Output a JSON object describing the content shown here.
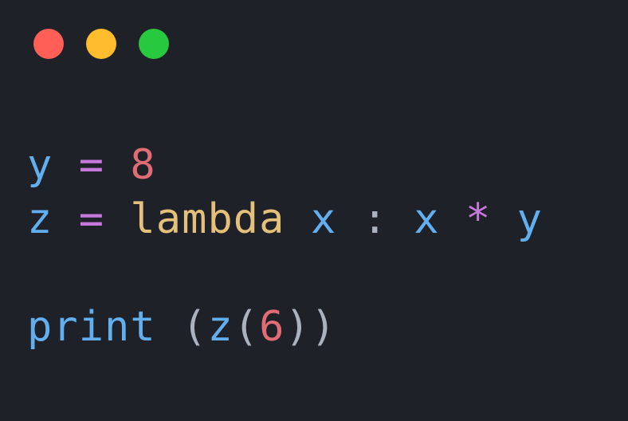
{
  "window_controls": {
    "close": "close",
    "minimize": "minimize",
    "maximize": "maximize"
  },
  "code": {
    "line1": {
      "var_y": "y",
      "eq": " = ",
      "val": "8"
    },
    "line2": {
      "var_z": "z",
      "eq": " = ",
      "kw": "lambda",
      "sp1": " ",
      "var_x1": "x",
      "colon_sp": " : ",
      "var_x2": "x",
      "star": " * ",
      "var_y2": "y"
    },
    "line4": {
      "fn": "print",
      "sp": " ",
      "paren_open": "(",
      "fn_z": "z",
      "paren_open2": "(",
      "arg": "6",
      "paren_close2": ")",
      "paren_close": ")"
    }
  }
}
